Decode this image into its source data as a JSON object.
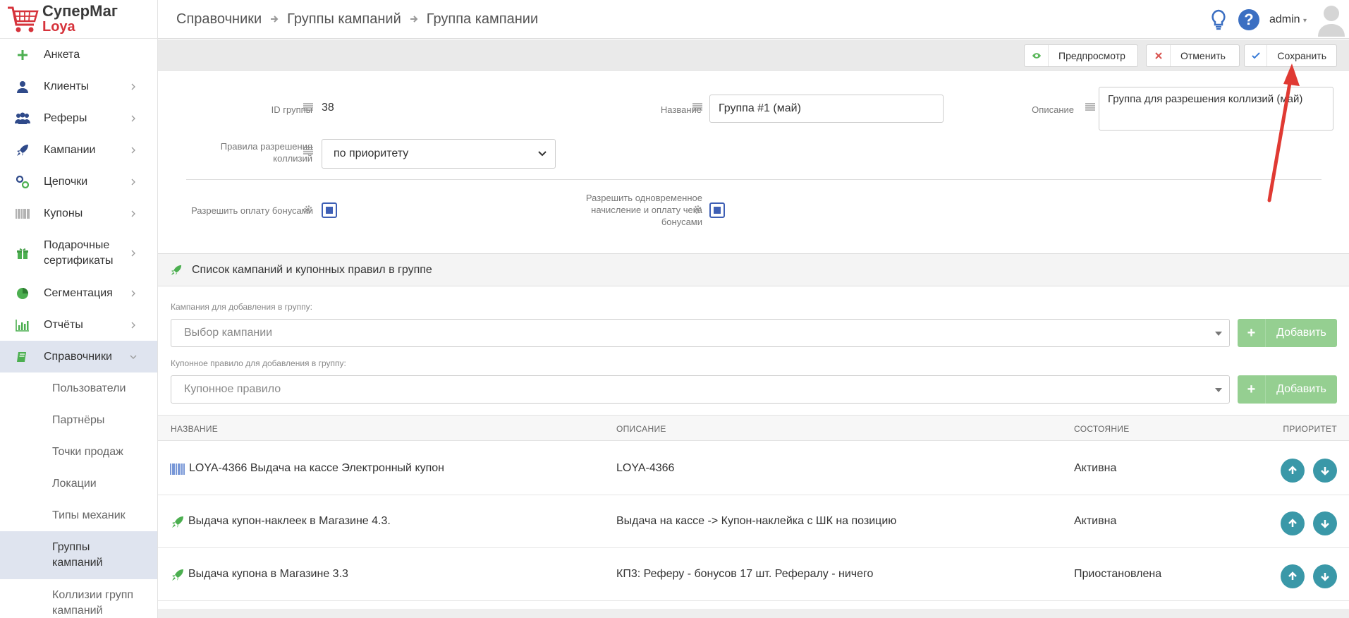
{
  "app": {
    "brand_line1": "СуперМаг",
    "brand_line2": "Loya"
  },
  "breadcrumb": [
    "Справочники",
    "Группы кампаний",
    "Группа кампании"
  ],
  "topbar": {
    "user": "admin"
  },
  "sidebar": {
    "items": [
      {
        "label": "Анкета",
        "icon": "plus-icon"
      },
      {
        "label": "Клиенты",
        "icon": "user-icon"
      },
      {
        "label": "Реферы",
        "icon": "users-icon"
      },
      {
        "label": "Кампании",
        "icon": "rocket-icon"
      },
      {
        "label": "Цепочки",
        "icon": "link-icon"
      },
      {
        "label": "Купоны",
        "icon": "barcode-icon"
      },
      {
        "label": "Подарочные сертификаты",
        "icon": "gift-icon"
      },
      {
        "label": "Сегментация",
        "icon": "pie-icon"
      },
      {
        "label": "Отчёты",
        "icon": "bar-chart-icon"
      },
      {
        "label": "Справочники",
        "icon": "book-icon"
      }
    ],
    "sub_items": [
      {
        "label": "Пользователи"
      },
      {
        "label": "Партнёры"
      },
      {
        "label": "Точки продаж"
      },
      {
        "label": "Локации"
      },
      {
        "label": "Типы механик"
      },
      {
        "label": "Группы кампаний"
      },
      {
        "label": "Коллизии групп кампаний"
      }
    ]
  },
  "actions": {
    "preview": "Предпросмотр",
    "cancel": "Отменить",
    "save": "Сохранить"
  },
  "form": {
    "id_label": "ID группы",
    "id_value": "38",
    "name_label": "Название",
    "name_value": "Группа #1 (май)",
    "desc_label": "Описание",
    "desc_value": "Группа для разрешения коллизий (май)",
    "rules_label_line1": "Правила разрешения",
    "rules_label_line2": "коллизий",
    "rules_value": "по приоритету",
    "allow_bonus_label": "Разрешить оплату бонусами",
    "allow_bonus_checked": true,
    "allow_simul_line1": "Разрешить одновременное",
    "allow_simul_line2": "начисление и оплату чека",
    "allow_simul_line3": "бонусами",
    "allow_simul_checked": true
  },
  "section": {
    "title": "Список кампаний и купонных правил в группе",
    "campaign_add_label": "Кампания для добавления в группу:",
    "campaign_placeholder": "Выбор кампании",
    "coupon_add_label": "Купонное правило для добавления в группу:",
    "coupon_placeholder": "Купонное правило",
    "add_button": "Добавить"
  },
  "table": {
    "headers": {
      "name": "Название",
      "description": "Описание",
      "state": "Состояние",
      "priority": "Приоритет"
    },
    "rows": [
      {
        "type": "barcode-icon",
        "name": "LOYA-4366 Выдача на кассе Электронный купон",
        "description": "LOYA-4366",
        "state": "Активна"
      },
      {
        "type": "rocket-icon",
        "name": "Выдача купон-наклеек в Магазине 4.3.",
        "description": "Выдача на кассе -> Купон-наклейка с ШК на позицию",
        "state": "Активна"
      },
      {
        "type": "rocket-icon",
        "name": "Выдача купона в Магазине 3.3",
        "description": "КП3: Реферу - бонусов 17 шт. Рефералу - ничего",
        "state": "Приостановлена"
      }
    ]
  },
  "colors": {
    "accent_green": "#5cb85c",
    "brand_red": "#d6333b",
    "priority_teal": "#3a98a8",
    "checkbox_blue": "#3e5fb5",
    "annotation_arrow": "#e03a33"
  }
}
